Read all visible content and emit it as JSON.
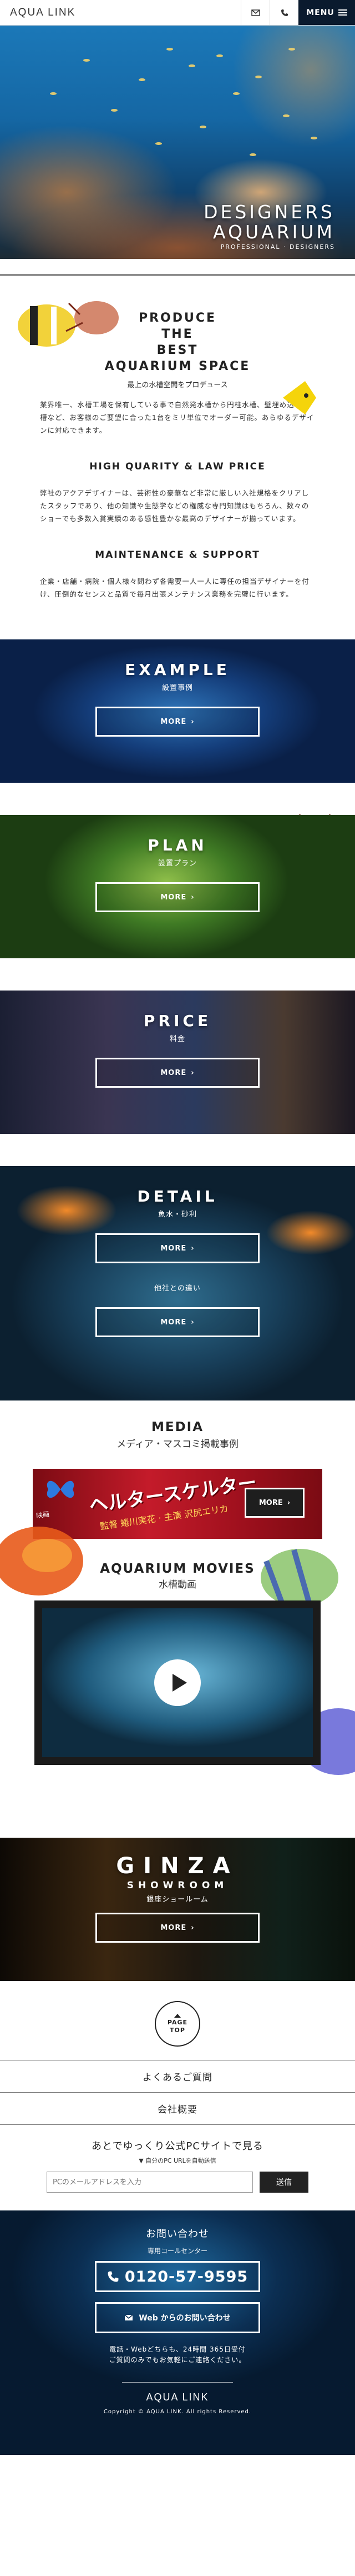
{
  "header": {
    "logo": "AQUA LINK",
    "mail_icon": "mail-icon",
    "phone_icon": "phone-icon",
    "menu_label": "MENU"
  },
  "hero": {
    "title_line1": "DESIGNERS",
    "title_line2": "AQUARIUM",
    "subtitle": "PROFESSIONAL · DESIGNERS"
  },
  "intro": {
    "heading_line1": "PRODUCE",
    "heading_line2": "THE",
    "heading_line3": "BEST",
    "heading_line4": "AQUARIUM SPACE",
    "caption": "最上の水槽空間をプロデュース",
    "paragraph": "業界唯一、水槽工場を保有している事で自然発水槽から円柱水槽、壁埋め込み水槽など、お客様のご要望に合った1台をミリ単位でオーダー可能。あらゆるデザインに対応できます。"
  },
  "quality": {
    "heading": "HIGH QUARITY & LAW PRICE",
    "paragraph": "弊社のアクアデザイナーは、芸術性の豪華など非常に厳しい入社規格をクリアしたスタッフであり、他の知識や生態学などの権威な専門知識はもちろん、数々のショーでも多数入賞実績のある感性豊かな最高のデザイナーが揃っています。"
  },
  "maintenance": {
    "heading": "MAINTENANCE & SUPPORT",
    "paragraph": "企業・店舗・病院・個人様々問わず各需要一人一人に専任の担当デザイナーを付け、圧倒的なセンスと品質で毎月出張メンテナンス業務を完璧に行います。"
  },
  "banners": {
    "example": {
      "title": "EXAMPLE",
      "sub": "設置事例",
      "button": "MORE"
    },
    "plan": {
      "title": "PLAN",
      "sub": "設置プラン",
      "button": "MORE"
    },
    "price": {
      "title": "PRICE",
      "sub": "料金",
      "button": "MORE"
    },
    "detail": {
      "title": "DETAIL",
      "sub": "魚水・砂利",
      "button": "MORE",
      "sub2": "他社との違い",
      "button2": "MORE"
    }
  },
  "media": {
    "heading": "MEDIA",
    "sub": "メディア・マスコミ掲載事例",
    "poster_title": "ヘルタースケルター",
    "poster_sub": "監督 蜷川実花 · 主演 沢尻エリカ",
    "poster_tag": "映画",
    "button": "MORE"
  },
  "movies": {
    "heading": "AQUARIUM MOVIES",
    "sub": "水槽動画",
    "play_icon": "play-icon"
  },
  "ginza": {
    "title": "GINZA",
    "sub": "SHOWROOM",
    "sub_jp": "銀座ショールーム",
    "button": "MORE"
  },
  "pagetop": {
    "line1": "PAGE",
    "line2": "TOP"
  },
  "footer_links": [
    "よくあるご質問",
    "会社概要"
  ],
  "pc_site": {
    "heading": "あとでゆっくり公式PCサイトで見る",
    "note": "▼ 自分のPC URLを自動送信",
    "input_placeholder": "PCのメールアドレスを入力",
    "send_label": "送信"
  },
  "contact": {
    "heading": "お問い合わせ",
    "sub": "専用コールセンター",
    "tel": "0120-57-9595",
    "web_label": "Web からのお問い合わせ",
    "note_line1": "電話・Webどちらも、24時間 365日受付",
    "note_line2": "ご質問のみでもお気軽にご連絡ください。",
    "footer_logo": "AQUA LINK",
    "copyright": "Copyright © AQUA LINK. All rights Reserved."
  },
  "colors": {
    "header_dark": "#0a1a2e",
    "text": "#222222",
    "accent_red": "#c41b2a"
  }
}
